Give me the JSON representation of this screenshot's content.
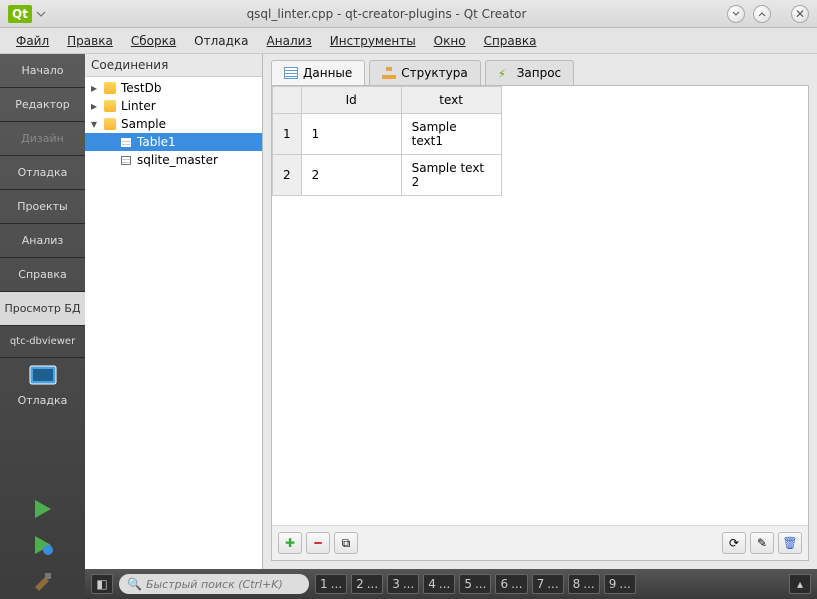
{
  "title": "qsql_linter.cpp - qt-creator-plugins - Qt Creator",
  "menu": [
    "Файл",
    "Правка",
    "Сборка",
    "Отладка",
    "Анализ",
    "Инструменты",
    "Окно",
    "Справка"
  ],
  "leftbar": {
    "items": [
      "Начало",
      "Редактор",
      "Дизайн",
      "Отладка",
      "Проекты",
      "Анализ",
      "Справка",
      "Просмотр БД"
    ],
    "section": "qtc-dbviewer",
    "debug": "Отладка"
  },
  "tree": {
    "header": "Соединения",
    "nodes": [
      {
        "label": "TestDb",
        "expanded": false,
        "type": "db"
      },
      {
        "label": "Linter",
        "expanded": false,
        "type": "db"
      },
      {
        "label": "Sample",
        "expanded": true,
        "type": "db",
        "children": [
          {
            "label": "Table1",
            "type": "table",
            "selected": true
          },
          {
            "label": "sqlite_master",
            "type": "table",
            "selected": false
          }
        ]
      }
    ]
  },
  "tabs": [
    {
      "label": "Данные",
      "icon": "data",
      "active": true
    },
    {
      "label": "Структура",
      "icon": "struct",
      "active": false
    },
    {
      "label": "Запрос",
      "icon": "query",
      "active": false
    }
  ],
  "table": {
    "headers": [
      "Id",
      "text"
    ],
    "rows": [
      {
        "n": "1",
        "Id": "1",
        "text": "Sample text1"
      },
      {
        "n": "2",
        "Id": "2",
        "text": "Sample text 2"
      }
    ]
  },
  "search_placeholder": "Быстрый поиск (Ctrl+K)",
  "bottom_nums": [
    "1",
    "2",
    "3",
    "4",
    "5",
    "6",
    "7",
    "8",
    "9"
  ]
}
